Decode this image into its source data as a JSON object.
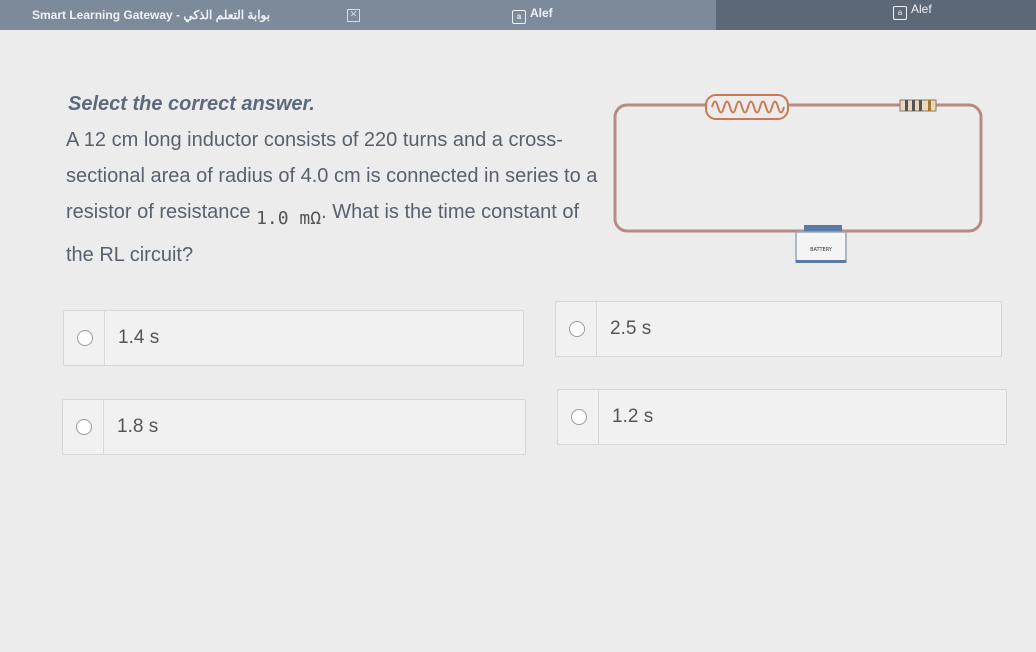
{
  "topbar": {
    "tab_title": "Smart Learning Gateway - بوابة التعلم الذكي",
    "app_name_center": "Alef",
    "app_name_right": "Alef"
  },
  "question": {
    "heading": "Select the correct answer.",
    "text_part1": "A 12 cm long inductor consists of 220 turns and a cross-sectional area of radius of 4.0 cm is connected in series to a resistor of resistance",
    "resistance": "1.0 mΩ",
    "text_part2": ". What is the time constant of the RL circuit?"
  },
  "circuit": {
    "battery_label": "BATTERY"
  },
  "options": [
    {
      "label": "1.4 s"
    },
    {
      "label": "2.5 s"
    },
    {
      "label": "1.8 s"
    },
    {
      "label": "1.2 s"
    }
  ],
  "colors": {
    "topbar": "#7d8a9a",
    "wire": "#b88a86",
    "inductor": "#c97a52",
    "background": "#ececec"
  }
}
